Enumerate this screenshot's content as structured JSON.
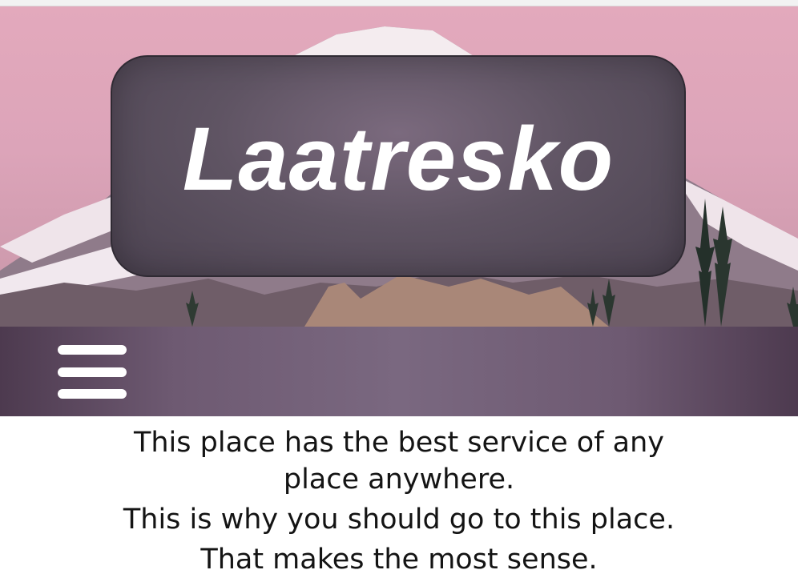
{
  "site": {
    "title": "Laatresko"
  },
  "nav": {
    "menu_icon": "hamburger-menu-icon"
  },
  "content": {
    "paragraph_1": "This place has the best service of any place anywhere.",
    "paragraph_2": "This is why you should go to this place.",
    "paragraph_3": "That makes the most sense."
  },
  "colors": {
    "sky": "#dca4b9",
    "title_panel": "#5f5463",
    "nav_bar": "#7a6880",
    "text": "#141414"
  }
}
